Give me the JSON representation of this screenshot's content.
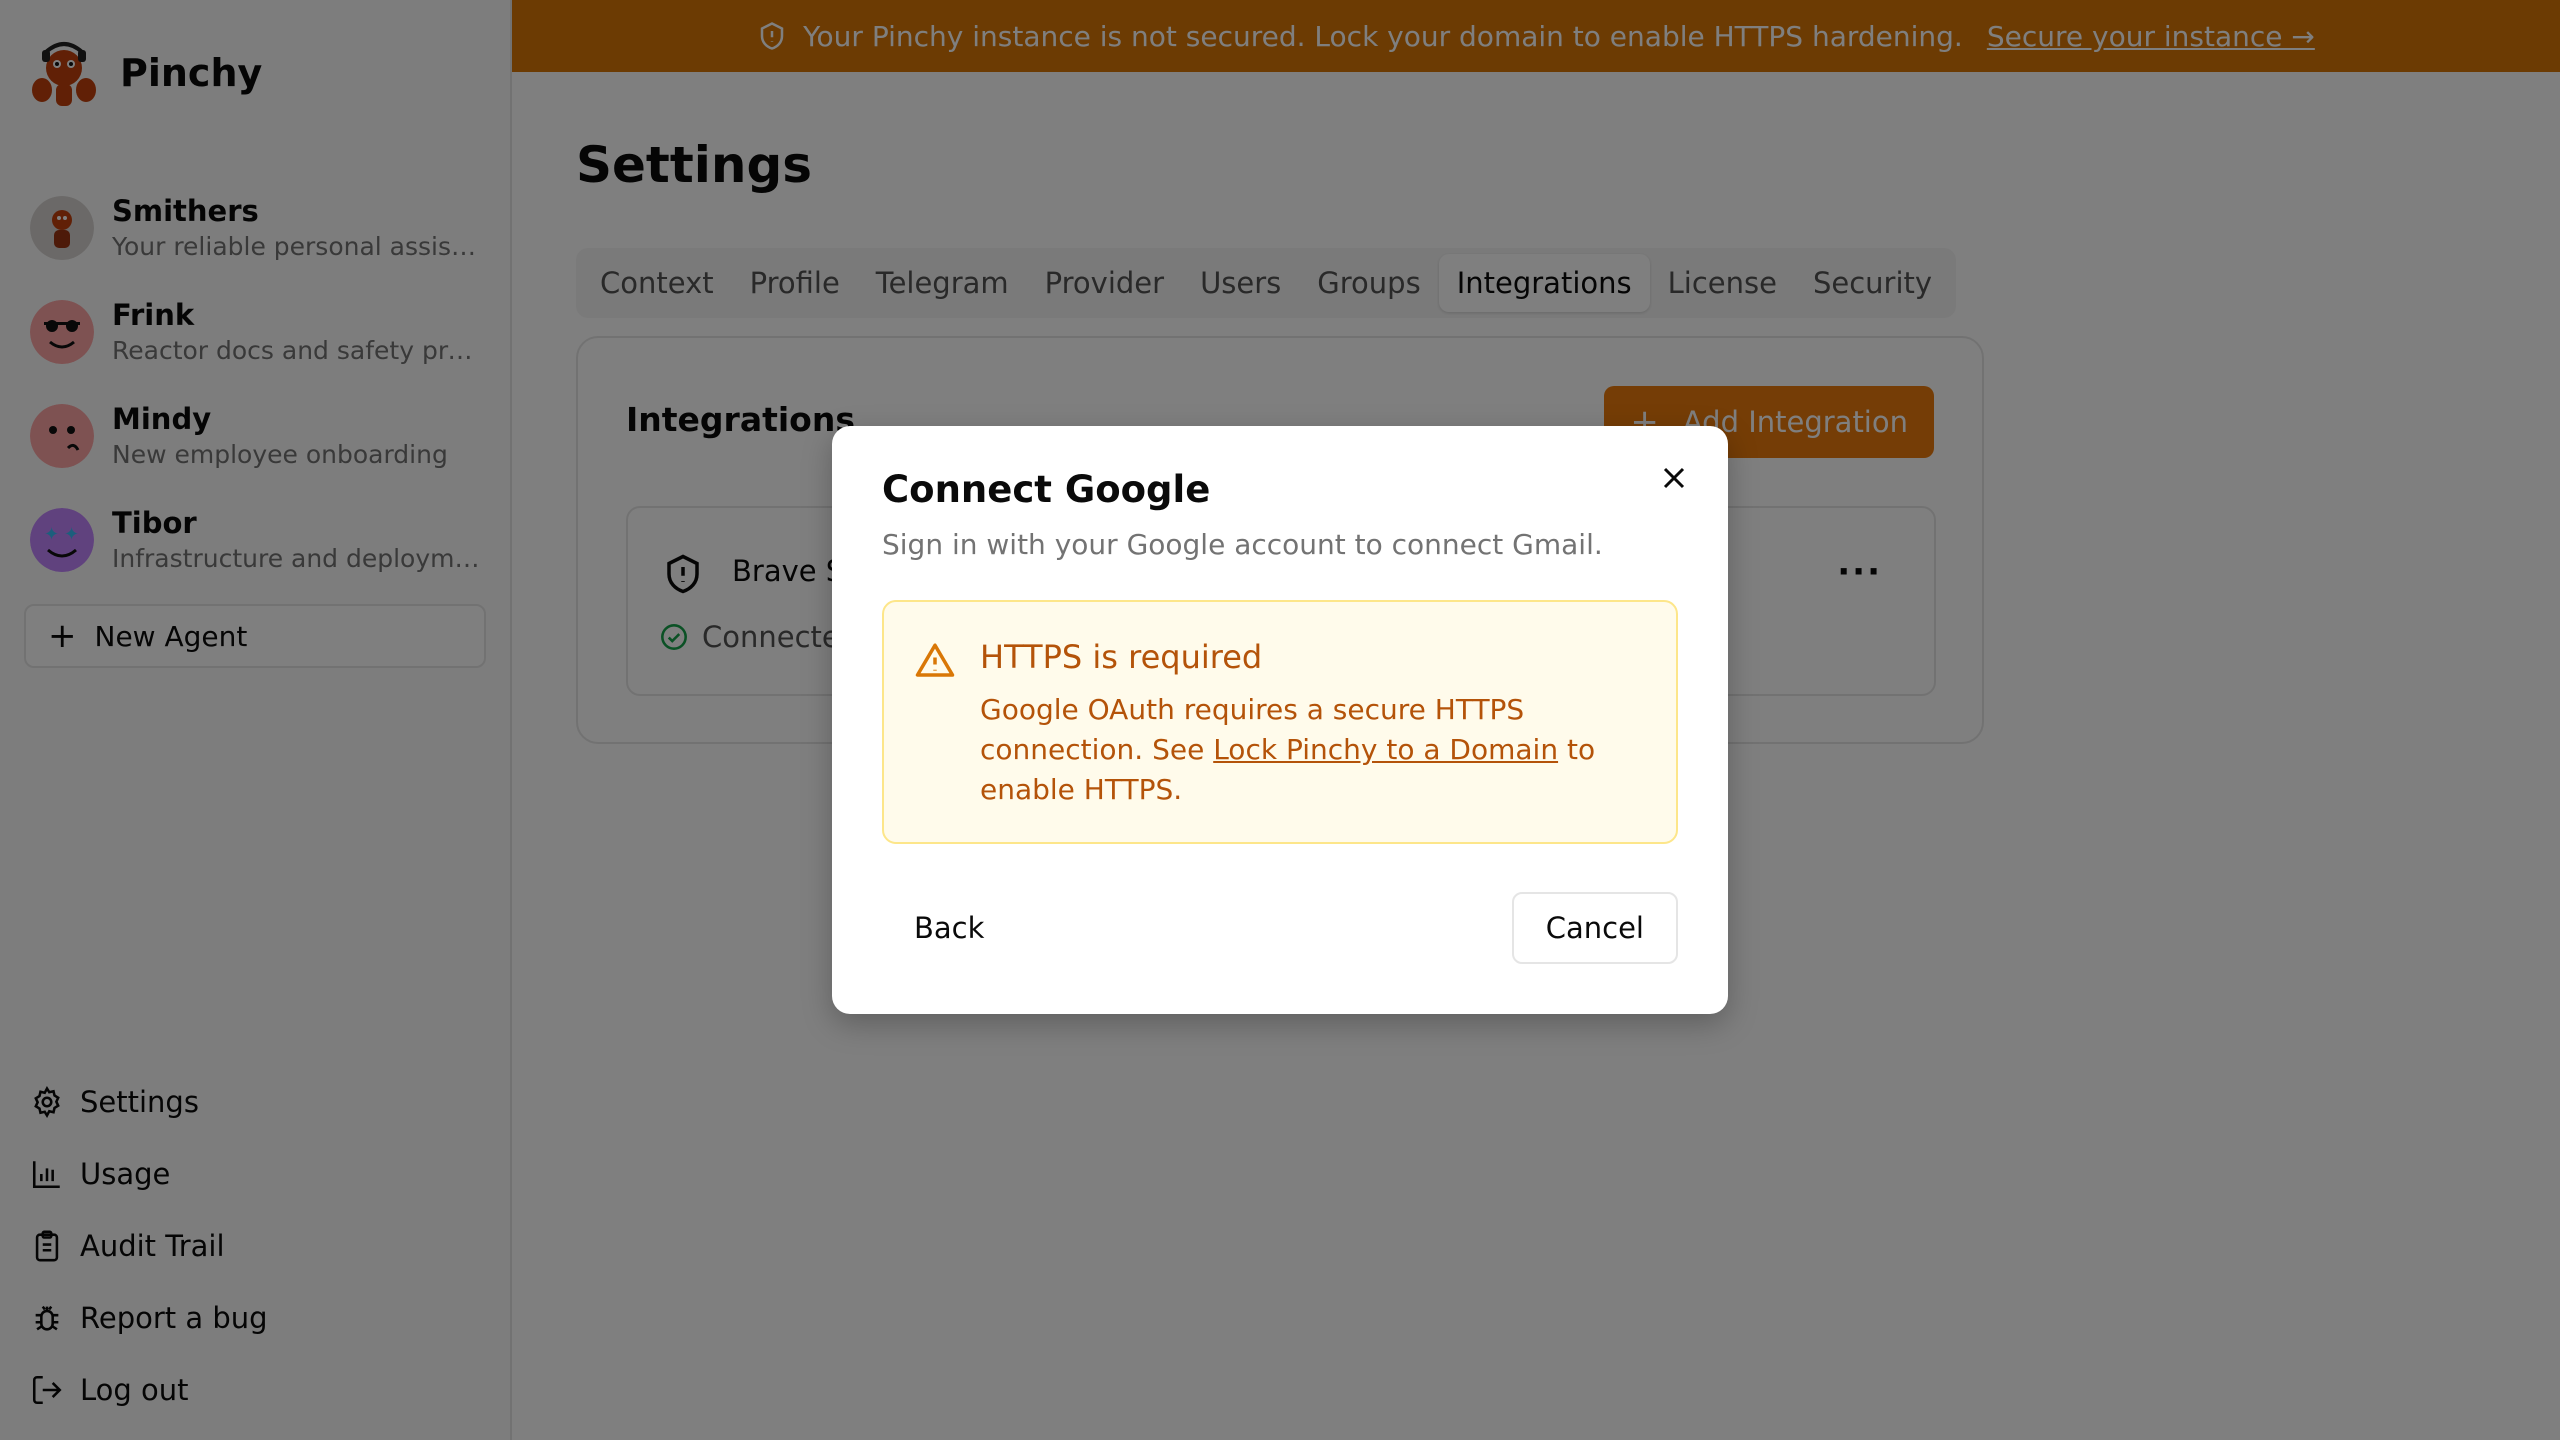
{
  "app": {
    "name": "Pinchy"
  },
  "agents": [
    {
      "name": "Smithers",
      "description": "Your reliable personal assistant"
    },
    {
      "name": "Frink",
      "description": "Reactor docs and safety procedures"
    },
    {
      "name": "Mindy",
      "description": "New employee onboarding"
    },
    {
      "name": "Tibor",
      "description": "Infrastructure and deployment"
    }
  ],
  "new_agent_label": "New Agent",
  "nav": {
    "settings": "Settings",
    "usage": "Usage",
    "audit": "Audit Trail",
    "bug": "Report a bug",
    "logout": "Log out"
  },
  "banner": {
    "text": "Your Pinchy instance is not secured. Lock your domain to enable HTTPS hardening.",
    "link": "Secure your instance →"
  },
  "page": {
    "title": "Settings"
  },
  "tabs": [
    "Context",
    "Profile",
    "Telegram",
    "Provider",
    "Users",
    "Groups",
    "Integrations",
    "License",
    "Security"
  ],
  "integrations": {
    "title": "Integrations",
    "add_label": "Add Integration",
    "item_name": "Brave S",
    "item_status": "Connecte"
  },
  "modal": {
    "title": "Connect Google",
    "subtitle": "Sign in with your Google account to connect Gmail.",
    "alert_title": "HTTPS is required",
    "alert_body_1": "Google OAuth requires a secure HTTPS connection. See ",
    "alert_link": "Lock Pinchy to a Domain",
    "alert_body_2": " to enable HTTPS.",
    "back": "Back",
    "cancel": "Cancel"
  },
  "colors": {
    "accent": "#ea7a0c",
    "banner": "#d97706",
    "warning_text": "#b45309"
  }
}
